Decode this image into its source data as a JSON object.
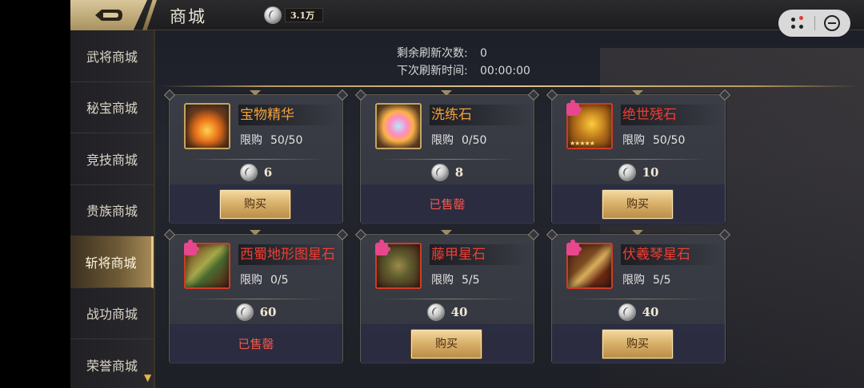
{
  "header": {
    "title": "商城",
    "currency_value": "3.1万"
  },
  "sidebar": {
    "items": [
      {
        "label": "武将商城"
      },
      {
        "label": "秘宝商城"
      },
      {
        "label": "竞技商城"
      },
      {
        "label": "贵族商城"
      },
      {
        "label": "斩将商城",
        "active": true
      },
      {
        "label": "战功商城"
      },
      {
        "label": "荣誉商城"
      }
    ]
  },
  "refresh": {
    "remaining_label": "剩余刷新次数:",
    "remaining_value": "0",
    "next_label": "下次刷新时间:",
    "next_value": "00:00:00"
  },
  "items": [
    {
      "name": "宝物精华",
      "name_color": "orange",
      "limit_label": "限购",
      "limit": "50/50",
      "price": "6",
      "status": "buy",
      "action_label": "购买",
      "icon": "treasure-essence-icon"
    },
    {
      "name": "洗练石",
      "name_color": "orange",
      "limit_label": "限购",
      "limit": "0/50",
      "price": "8",
      "status": "soldout",
      "action_label": "已售罄",
      "icon": "refine-stone-icon"
    },
    {
      "name": "绝世残石",
      "name_color": "red",
      "limit_label": "限购",
      "limit": "50/50",
      "price": "10",
      "status": "buy",
      "action_label": "购买",
      "icon": "peerless-fragment-icon"
    },
    {
      "name": "西蜀地形图星石",
      "name_color": "red",
      "limit_label": "限购",
      "limit": "0/5",
      "price": "60",
      "status": "soldout",
      "action_label": "已售罄",
      "icon": "shu-map-star-stone-icon"
    },
    {
      "name": "藤甲星石",
      "name_color": "red",
      "limit_label": "限购",
      "limit": "5/5",
      "price": "40",
      "status": "buy",
      "action_label": "购买",
      "icon": "rattan-armor-star-stone-icon"
    },
    {
      "name": "伏羲琴星石",
      "name_color": "red",
      "limit_label": "限购",
      "limit": "5/5",
      "price": "40",
      "status": "buy",
      "action_label": "购买",
      "icon": "fuxi-qin-star-stone-icon"
    }
  ],
  "colors": {
    "accent_gold": "#d9b26c",
    "name_orange": "#f2a13a",
    "name_red": "#ef3d33",
    "soldout_red": "#f3574a"
  }
}
